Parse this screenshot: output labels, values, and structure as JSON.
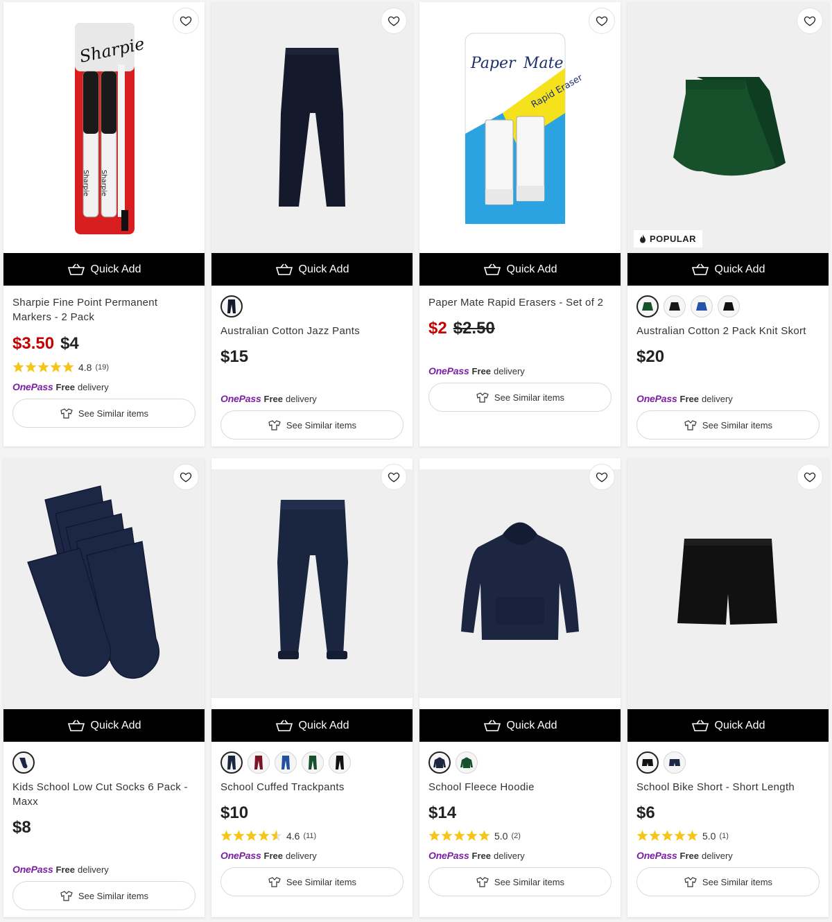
{
  "common": {
    "quick_add": "Quick Add",
    "see_similar": "See Similar items",
    "onepass_brand": "OnePass",
    "onepass_free": "Free",
    "onepass_delivery": "delivery",
    "popular_badge": "POPULAR"
  },
  "colors": {
    "quick_add_bg": "#000000",
    "sale_price": "#c40000",
    "onepass_purple": "#7a1fa2",
    "star": "#f5c518"
  },
  "products": [
    {
      "title": "Sharpie Fine Point Permanent Markers - 2 Pack",
      "price_sale": "$3.50",
      "price_was": "$4",
      "rating": "4.8",
      "rating_count": "(19)",
      "stars": 5,
      "image": "sharpie-markers"
    },
    {
      "title": "Australian Cotton Jazz Pants",
      "price": "$15",
      "swatches": [
        "navy-pants"
      ],
      "image": "navy-jazz-pants"
    },
    {
      "title": "Paper Mate Rapid Erasers - Set of 2",
      "price_sale": "$2",
      "price_was": "$2.50",
      "image": "paper-mate-erasers"
    },
    {
      "title": "Australian Cotton 2 Pack Knit Skort",
      "price": "$20",
      "badge": "POPULAR",
      "swatches": [
        "green-skort",
        "black-skort",
        "blue-skort",
        "black-skort-2"
      ],
      "image": "green-skort"
    },
    {
      "title": "Kids School Low Cut Socks 6 Pack - Maxx",
      "price": "$8",
      "swatches": [
        "navy-socks"
      ],
      "image": "navy-socks"
    },
    {
      "title": "School Cuffed Trackpants",
      "price": "$10",
      "rating": "4.6",
      "rating_count": "(11)",
      "stars": 4.5,
      "swatches": [
        "navy-trackpants",
        "maroon-trackpants",
        "blue-trackpants",
        "green-trackpants",
        "black-trackpants"
      ],
      "image": "navy-trackpants"
    },
    {
      "title": "School Fleece Hoodie",
      "price": "$14",
      "rating": "5.0",
      "rating_count": "(2)",
      "stars": 5,
      "swatches": [
        "navy-hoodie",
        "green-hoodie"
      ],
      "image": "navy-hoodie"
    },
    {
      "title": "School Bike Short - Short Length",
      "price": "$6",
      "rating": "5.0",
      "rating_count": "(1)",
      "stars": 5,
      "swatches": [
        "black-short",
        "navy-short"
      ],
      "image": "black-bike-short"
    }
  ]
}
